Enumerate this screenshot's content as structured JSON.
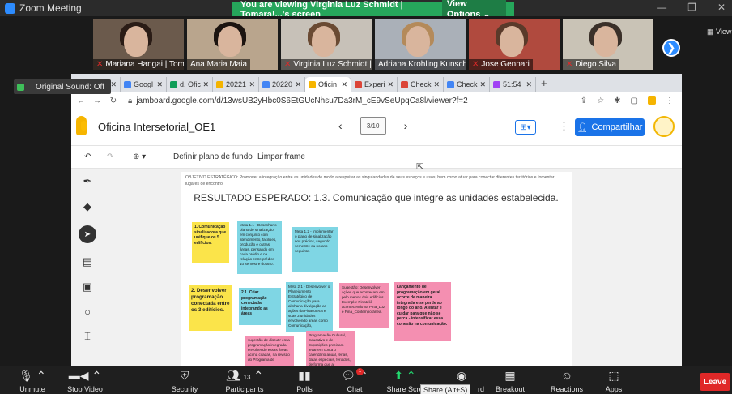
{
  "zoom": {
    "window_title": "Zoom Meeting",
    "share_banner": "You are viewing Virginia Luz Schmidt | Tomara!...'s screen",
    "view_options": "View Options ⌄",
    "view_button": "▦ View",
    "original_sound": "Original Sound: Off",
    "participants": [
      {
        "name": "Mariana Hangai | Tom...",
        "muted": true,
        "bg": "#6b5a4c",
        "hair": "#2a1c16"
      },
      {
        "name": "Ana Maria Maia",
        "muted": false,
        "bg": "#b9a58d",
        "hair": "#1c1410"
      },
      {
        "name": "Virginia Luz Schmidt | To...",
        "muted": true,
        "bg": "#c7c1b8",
        "hair": "#6a4a33"
      },
      {
        "name": "Adriana Krohling Kunsch",
        "muted": false,
        "bg": "#aab0b8",
        "hair": "#b48a5a"
      },
      {
        "name": "Jose Gennari",
        "muted": true,
        "bg": "#b04a3e",
        "hair": "#5a3a2a"
      },
      {
        "name": "Diego Silva",
        "muted": true,
        "bg": "#c9c3b6",
        "hair": "#3a3029"
      }
    ],
    "toolbar": {
      "unmute": "Unmute",
      "stop_video": "Stop Video",
      "security": "Security",
      "participants": "Participants",
      "participants_count": "13",
      "polls": "Polls",
      "chat": "Chat",
      "chat_badge": "1",
      "share_screen": "Share Scre",
      "share_screen_tail": "rd",
      "breakout": "Breakout Rooms",
      "reactions": "Reactions",
      "apps": "Apps",
      "leave": "Leave",
      "tooltip": "Share (Alt+S)"
    }
  },
  "browser": {
    "tabs": [
      {
        "label": "",
        "color": "#888",
        "active": false
      },
      {
        "label": "Googl",
        "color": "#4285f4",
        "active": false
      },
      {
        "label": "d. Ofic",
        "color": "#0f9d58",
        "active": false
      },
      {
        "label": "20221",
        "color": "#f4b400",
        "active": false
      },
      {
        "label": "20220",
        "color": "#4285f4",
        "active": false
      },
      {
        "label": "Oficin",
        "color": "#f6b500",
        "active": true
      },
      {
        "label": "Experi",
        "color": "#db4437",
        "active": false
      },
      {
        "label": "Check",
        "color": "#db4437",
        "active": false
      },
      {
        "label": "Check",
        "color": "#4285f4",
        "active": false
      },
      {
        "label": "51:54",
        "color": "#a142f4",
        "active": false
      }
    ],
    "new_tab": "+",
    "url": "jamboard.google.com/d/13wsUB2yHbc0S6EtGUcNhsu7Da3rM_cE9vSeUpqCa8l/viewer?f=2"
  },
  "jamboard": {
    "title": "Oficina Intersetorial_OE1",
    "frame_counter": "3/10",
    "share_label": "Compartilhar",
    "set_background": "Definir plano de fundo",
    "clear_frame": "Limpar frame",
    "objective": "OBJETIVO ESTRATÉGICO: Promover a integração entre as unidades de modo a respeitar as singularidades de seus espaços e usos, bem como atuar para conectar diferentes territórios e fomentar lugares de encontro.",
    "heading": "RESULTADO ESPERADO: 1.3. Comunicação que integre as unidades estabelecida.",
    "notes": {
      "n1": "1. Comunicação sinalizadora que unifique os 5 edifícios.",
      "n2": "Meta 1.1 - Desenhar o plano de sinalização em conjunto com atendimento, facilities, produção e outras áreas, pensando em cada prédio e na relação entre prédios - 1o semestre do ano.",
      "n3": "Meta 1.2 - Implementar o plano de sinalização nos prédios, segundo semestre ou no ano seguinte.",
      "n4": "2. Desenvolver programação conectada entre os 3 edifícios.",
      "n5": "2.1. Criar programação conectada integrando as áreas",
      "n6": "Meta 2.1 - Desenvolver o Planejamento Estratégico de Comunicação para alinhar a divulgação as ações da Pinacoteca e suas 3 unidades envolvendo áreas como Comunicação,",
      "n7": "Sugestão: Desenvolver ações que aconteçam em pelo menos dois edifícios. Exemplo: Pinateliê acontecendo na Pina_Luz e Pina_Contemporânea.",
      "n8": "Lançamento de programação em geral ocorre de maneira integrada e se perde ao longo do ano. Atentar e cuidar para que não se perca - intensificar essa conexão na comunicação.",
      "n9": "sugestão de discutir essa programação integrada, envolvendo essas áreas acima citadas, na revisão do Programa de",
      "n10": "Programação Cultural, Educativo e de Exposições precisam levar em conta o calendário anual, férias, datas especiais, feriados, de forma que a programação"
    }
  }
}
